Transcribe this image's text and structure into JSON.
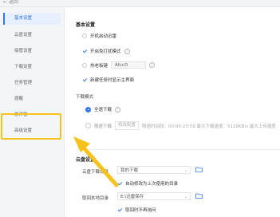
{
  "topbar": {
    "back_label": "返回"
  },
  "sidebar": {
    "items": [
      {
        "label": "基本设置"
      },
      {
        "label": "云盘设置"
      },
      {
        "label": "接管设置"
      },
      {
        "label": "下载设置"
      },
      {
        "label": "任务管理"
      },
      {
        "label": "提醒"
      },
      {
        "label": "悬浮窗"
      },
      {
        "label": "高级设置"
      }
    ]
  },
  "basic": {
    "title": "基本设置",
    "autostart": "开机启动迅雷",
    "autostart_checked": false,
    "freemode": "开启免打扰模式",
    "freemode_checked": true,
    "hotkey_label": "老板键",
    "hotkey_prefix": "热",
    "hotkey_value": "Alt+D",
    "hotkey_checked": false,
    "newtask": "新建任务时显示主界面",
    "newtask_checked": true
  },
  "download_mode": {
    "title": "下载模式",
    "full_speed": "全速下载",
    "full_speed_checked": true,
    "limit_speed": "限速下载",
    "limit_speed_checked": false,
    "modify_button": "修改配置",
    "limit_info": "限速时间段：00:00-23:59  最大下载速度：5120KB/s  最大上传速度"
  },
  "cloud": {
    "title": "云盘设置",
    "download_dir_label": "云盘下载目录",
    "download_dir_value": "我的下载",
    "auto_modify": "自动修改为上次使用的目录",
    "auto_modify_checked": true,
    "local_dir_label": "取回本地目录",
    "local_dir_value": "E:\\迅雷保存",
    "no_ask": "取回时不再询问",
    "no_ask_checked": true
  },
  "colors": {
    "accent": "#3477f5",
    "highlight": "#f7c21c"
  }
}
